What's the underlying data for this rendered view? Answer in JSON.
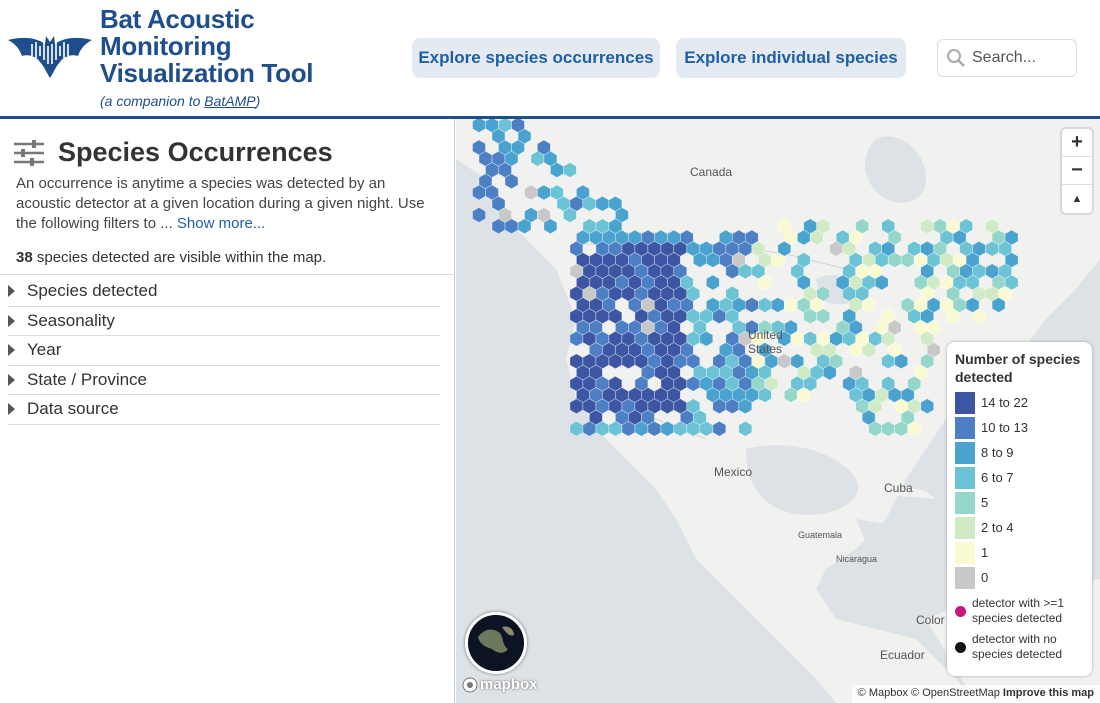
{
  "header": {
    "title_lines": [
      "Bat Acoustic",
      "Monitoring",
      "Visualization Tool"
    ],
    "subtitle_prefix": "(a companion to ",
    "subtitle_link": "BatAMP",
    "subtitle_suffix": ")",
    "nav": {
      "occurrences": "Explore species occurrences",
      "individual": "Explore individual species"
    },
    "search": {
      "placeholder": "Search..."
    }
  },
  "sidebar": {
    "title": "Species Occurrences",
    "description": "An occurrence is anytime a species was detected by an acoustic detector at a given location during a given night. Use the following filters to ...",
    "show_more": "Show more...",
    "count_value": "38",
    "count_text": " species detected are visible within the map.",
    "filters": [
      {
        "label": "Species detected"
      },
      {
        "label": "Seasonality"
      },
      {
        "label": "Year"
      },
      {
        "label": "State / Province"
      },
      {
        "label": "Data source"
      }
    ]
  },
  "map": {
    "labels": {
      "canada": "Canada",
      "united_states": "United\nStates",
      "mexico": "Mexico",
      "cuba": "Cuba",
      "guatemala": "Guatemala",
      "nicaragua": "Nicaragua",
      "colombia": "Color",
      "ecuador": "Ecuador"
    },
    "zoom": {
      "in": "+",
      "out": "−",
      "compass": "▲"
    },
    "legend": {
      "title": "Number of species detected",
      "classes": [
        {
          "label": "14 to 22",
          "color": "#3d56a3"
        },
        {
          "label": "10 to 13",
          "color": "#4d7fc4"
        },
        {
          "label": "8 to 9",
          "color": "#4aa3cf"
        },
        {
          "label": "6 to 7",
          "color": "#6cc3d5"
        },
        {
          "label": "5",
          "color": "#95d6ca"
        },
        {
          "label": "2 to 4",
          "color": "#cfeac4"
        },
        {
          "label": "1",
          "color": "#fafad2"
        },
        {
          "label": "0",
          "color": "#c8c8c8"
        }
      ],
      "detector_with": "detector with >=1 species detected",
      "detector_with_color": "#c2187f",
      "detector_none": "detector with no species detected",
      "detector_none_color": "#111111"
    },
    "mapbox_logo": "mapbox",
    "attribution": {
      "mapbox": "© Mapbox",
      "osm": "© OpenStreetMap",
      "improve": "Improve this map"
    }
  }
}
